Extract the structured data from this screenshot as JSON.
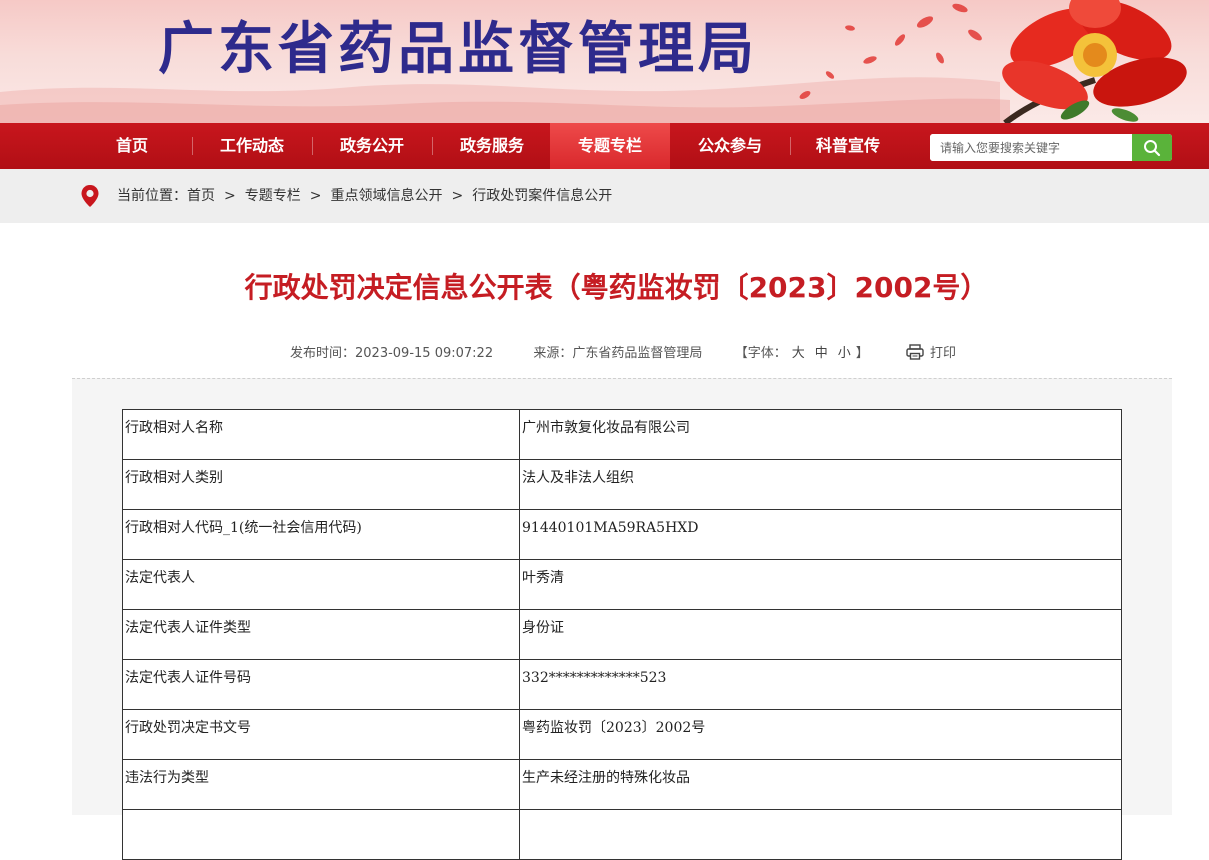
{
  "header": {
    "site_title": "广东省药品监督管理局"
  },
  "nav": {
    "items": [
      {
        "label": "首页"
      },
      {
        "label": "工作动态"
      },
      {
        "label": "政务公开"
      },
      {
        "label": "政务服务"
      },
      {
        "label": "专题专栏",
        "active": true
      },
      {
        "label": "公众参与"
      },
      {
        "label": "科普宣传"
      }
    ],
    "search_placeholder": "请输入您要搜索关键字",
    "search_icon": "magnifier-icon"
  },
  "breadcrumb": {
    "prefix": "当前位置：",
    "items": [
      "首页",
      "专题专栏",
      "重点领域信息公开",
      "行政处罚案件信息公开"
    ],
    "separator": ">"
  },
  "article": {
    "title": "行政处罚决定信息公开表（粤药监妆罚〔2023〕2002号）",
    "publish_label": "发布时间：",
    "publish_time": "2023-09-15 09:07:22",
    "source_label": "来源：",
    "source": "广东省药品监督管理局",
    "font_open": "【字体：",
    "font_large": "大",
    "font_medium": "中",
    "font_small": "小",
    "font_close": "】",
    "print_label": "打印"
  },
  "table": {
    "rows": [
      {
        "key": "行政相对人名称",
        "value": "广州市敦复化妆品有限公司"
      },
      {
        "key": "行政相对人类别",
        "value": "法人及非法人组织"
      },
      {
        "key": "行政相对人代码_1(统一社会信用代码)",
        "value": "91440101MA59RA5HXD"
      },
      {
        "key": "法定代表人",
        "value": "叶秀清"
      },
      {
        "key": "法定代表人证件类型",
        "value": "身份证"
      },
      {
        "key": "法定代表人证件号码",
        "value": "332*************523"
      },
      {
        "key": "行政处罚决定书文号",
        "value": "粤药监妆罚〔2023〕2002号"
      },
      {
        "key": "违法行为类型",
        "value": "生产未经注册的特殊化妆品"
      },
      {
        "key": "",
        "value": ""
      }
    ]
  },
  "colors": {
    "nav_red": "#c8161d",
    "title_red": "#c51d23",
    "site_title_blue": "#2e2a8c",
    "search_green": "#5ab33a"
  }
}
